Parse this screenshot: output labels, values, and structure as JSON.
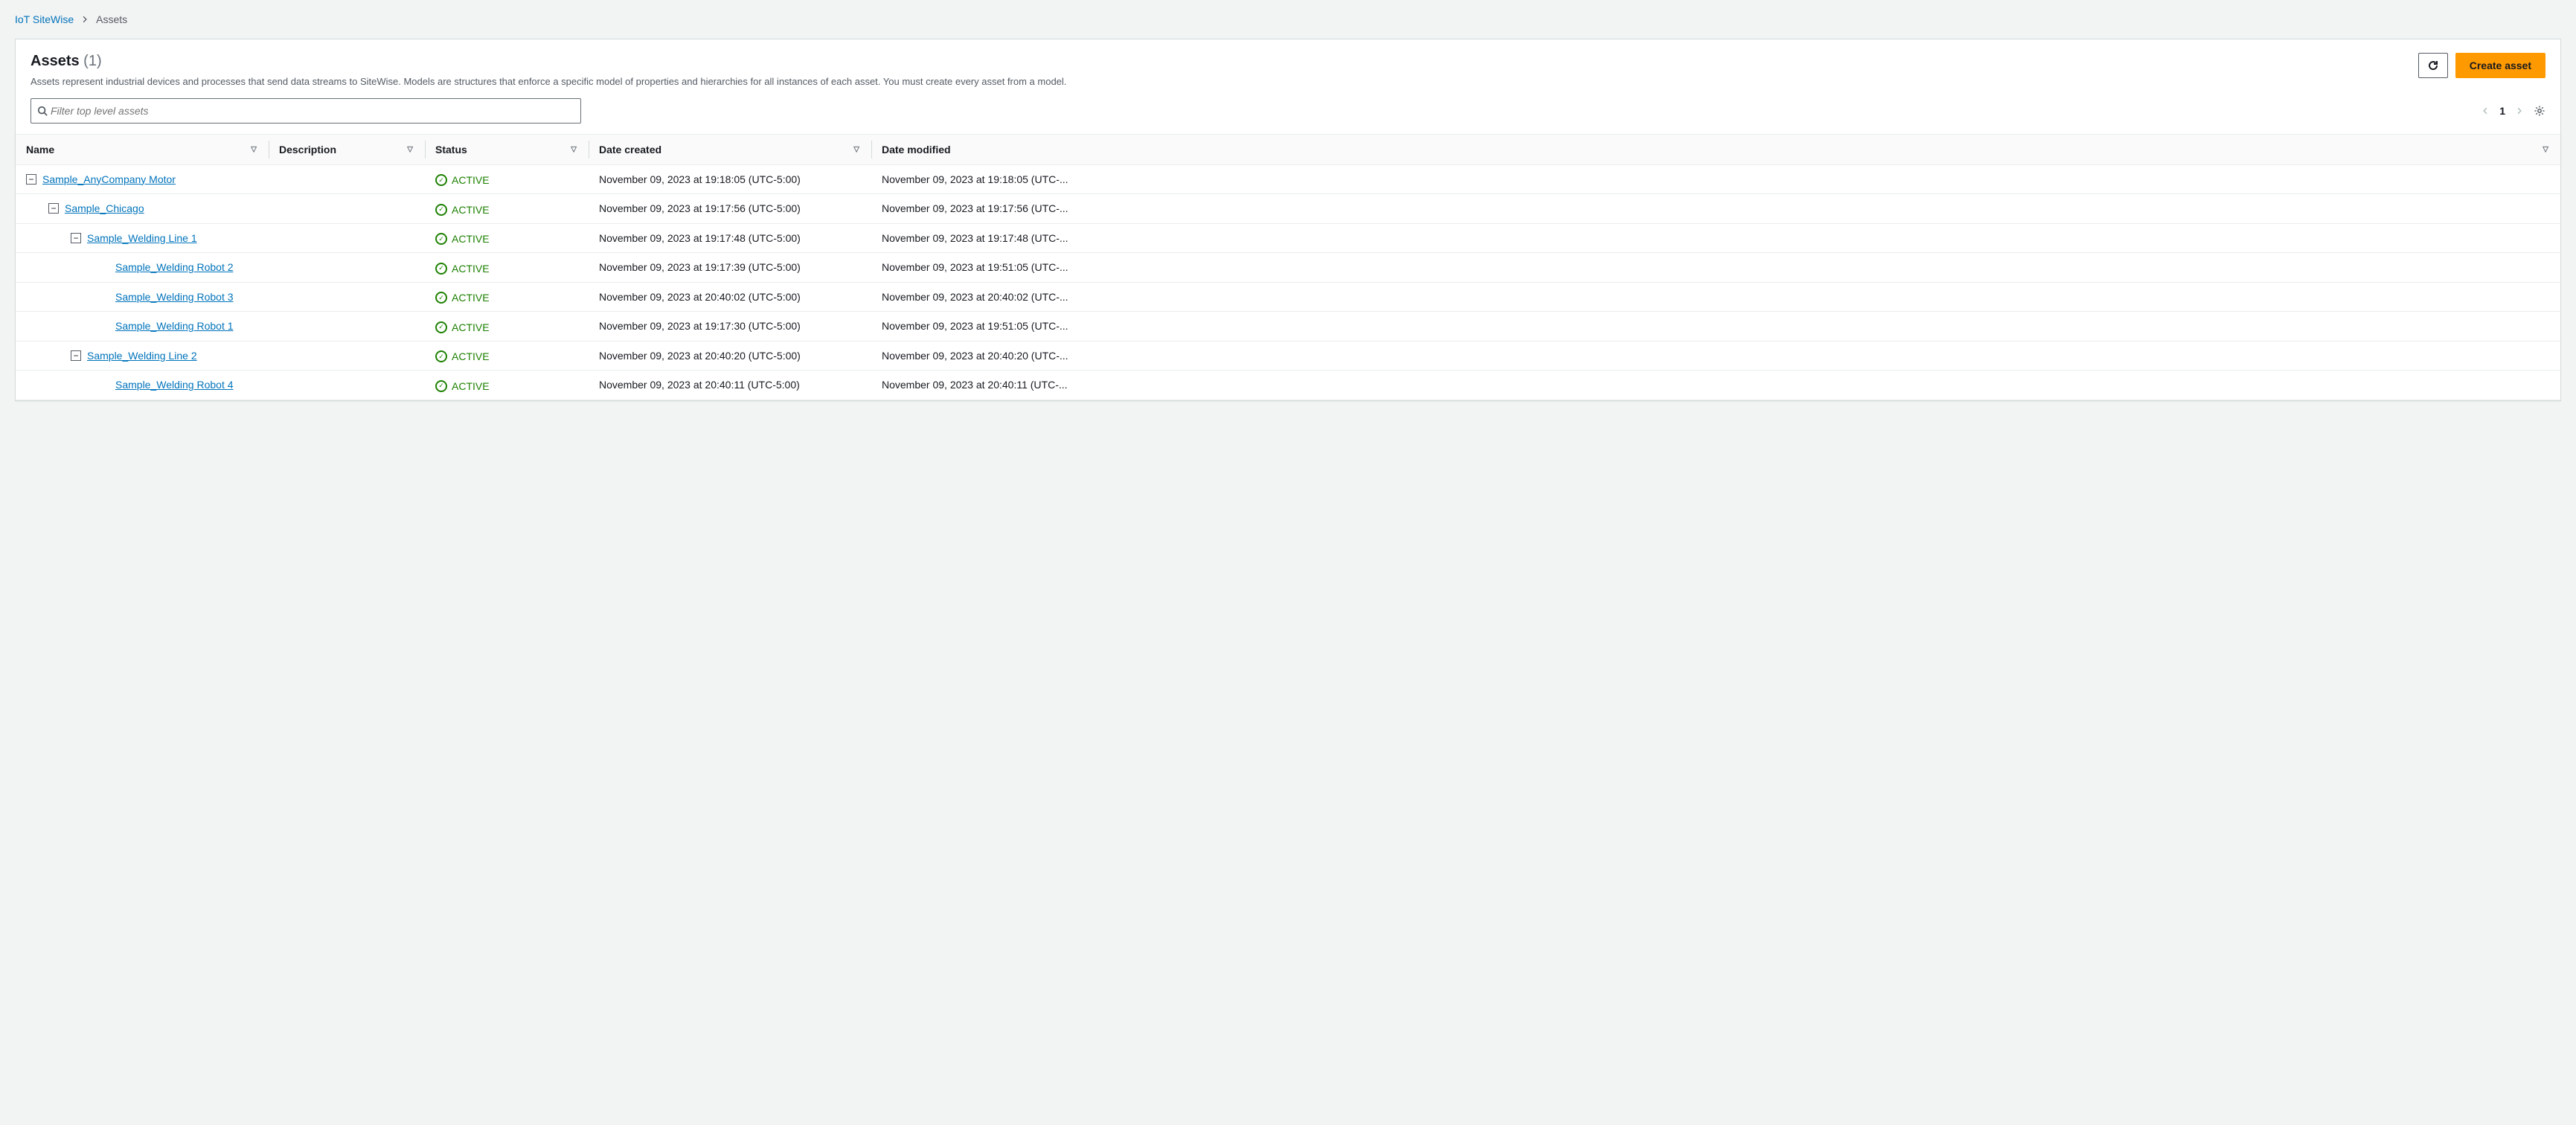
{
  "breadcrumb": {
    "root": "IoT SiteWise",
    "current": "Assets"
  },
  "header": {
    "title": "Assets",
    "count": "(1)",
    "description": "Assets represent industrial devices and processes that send data streams to SiteWise. Models are structures that enforce a specific model of properties and hierarchies for all instances of each asset. You must create every asset from a model.",
    "refresh_label": "Refresh",
    "create_label": "Create asset"
  },
  "filter": {
    "placeholder": "Filter top level assets"
  },
  "pagination": {
    "page": "1"
  },
  "columns": {
    "name": "Name",
    "description": "Description",
    "status": "Status",
    "created": "Date created",
    "modified": "Date modified"
  },
  "status_label": "ACTIVE",
  "rows": [
    {
      "indent": 0,
      "expandable": true,
      "name": "Sample_AnyCompany Motor",
      "description": "",
      "status": "ACTIVE",
      "created": "November 09, 2023 at 19:18:05 (UTC-5:00)",
      "modified": "November 09, 2023 at 19:18:05 (UTC-..."
    },
    {
      "indent": 1,
      "expandable": true,
      "name": "Sample_Chicago",
      "description": "",
      "status": "ACTIVE",
      "created": "November 09, 2023 at 19:17:56 (UTC-5:00)",
      "modified": "November 09, 2023 at 19:17:56 (UTC-..."
    },
    {
      "indent": 2,
      "expandable": true,
      "name": "Sample_Welding Line 1",
      "description": "",
      "status": "ACTIVE",
      "created": "November 09, 2023 at 19:17:48 (UTC-5:00)",
      "modified": "November 09, 2023 at 19:17:48 (UTC-..."
    },
    {
      "indent": 3,
      "expandable": false,
      "name": "Sample_Welding Robot 2",
      "description": "",
      "status": "ACTIVE",
      "created": "November 09, 2023 at 19:17:39 (UTC-5:00)",
      "modified": "November 09, 2023 at 19:51:05 (UTC-..."
    },
    {
      "indent": 3,
      "expandable": false,
      "name": "Sample_Welding Robot 3",
      "description": "",
      "status": "ACTIVE",
      "created": "November 09, 2023 at 20:40:02 (UTC-5:00)",
      "modified": "November 09, 2023 at 20:40:02 (UTC-..."
    },
    {
      "indent": 3,
      "expandable": false,
      "name": "Sample_Welding Robot 1",
      "description": "",
      "status": "ACTIVE",
      "created": "November 09, 2023 at 19:17:30 (UTC-5:00)",
      "modified": "November 09, 2023 at 19:51:05 (UTC-..."
    },
    {
      "indent": 2,
      "expandable": true,
      "name": "Sample_Welding Line 2",
      "description": "",
      "status": "ACTIVE",
      "created": "November 09, 2023 at 20:40:20 (UTC-5:00)",
      "modified": "November 09, 2023 at 20:40:20 (UTC-..."
    },
    {
      "indent": 3,
      "expandable": false,
      "name": "Sample_Welding Robot 4",
      "description": "",
      "status": "ACTIVE",
      "created": "November 09, 2023 at 20:40:11 (UTC-5:00)",
      "modified": "November 09, 2023 at 20:40:11 (UTC-..."
    }
  ]
}
